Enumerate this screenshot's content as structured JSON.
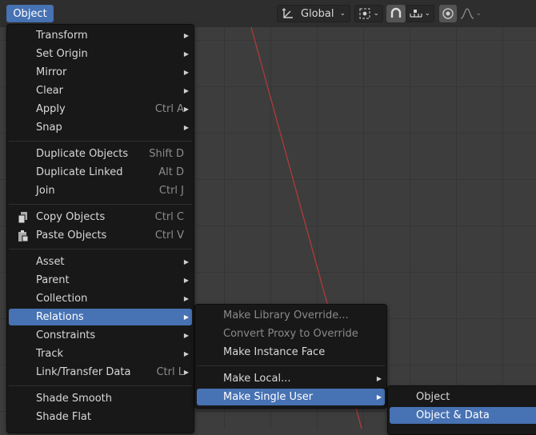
{
  "header": {
    "object_menu": "Object",
    "orientation": "Global",
    "icons": [
      "transform-orientation-icon",
      "pivot-point-icon",
      "snap-magnet-icon",
      "snap-increment-icon",
      "proportional-edit-icon",
      "falloff-curve-icon"
    ]
  },
  "object_menu": {
    "items": [
      {
        "label": "Transform",
        "shortcut": "",
        "submenu": true
      },
      {
        "label": "Set Origin",
        "shortcut": "",
        "submenu": true
      },
      {
        "label": "Mirror",
        "shortcut": "",
        "submenu": true
      },
      {
        "label": "Clear",
        "shortcut": "",
        "submenu": true
      },
      {
        "label": "Apply",
        "shortcut": "Ctrl A",
        "submenu": true
      },
      {
        "label": "Snap",
        "shortcut": "",
        "submenu": true
      },
      {
        "label": "Duplicate Objects",
        "shortcut": "Shift D",
        "submenu": false
      },
      {
        "label": "Duplicate Linked",
        "shortcut": "Alt D",
        "submenu": false
      },
      {
        "label": "Join",
        "shortcut": "Ctrl J",
        "submenu": false
      },
      {
        "label": "Copy Objects",
        "shortcut": "Ctrl C",
        "submenu": false,
        "icon": "copy-icon"
      },
      {
        "label": "Paste Objects",
        "shortcut": "Ctrl V",
        "submenu": false,
        "icon": "paste-icon"
      },
      {
        "label": "Asset",
        "shortcut": "",
        "submenu": true
      },
      {
        "label": "Parent",
        "shortcut": "",
        "submenu": true
      },
      {
        "label": "Collection",
        "shortcut": "",
        "submenu": true
      },
      {
        "label": "Relations",
        "shortcut": "",
        "submenu": true,
        "highlighted": true
      },
      {
        "label": "Constraints",
        "shortcut": "",
        "submenu": true
      },
      {
        "label": "Track",
        "shortcut": "",
        "submenu": true
      },
      {
        "label": "Link/Transfer Data",
        "shortcut": "Ctrl L",
        "submenu": true
      },
      {
        "label": "Shade Smooth",
        "shortcut": "",
        "submenu": false
      },
      {
        "label": "Shade Flat",
        "shortcut": "",
        "submenu": false
      }
    ]
  },
  "relations_menu": {
    "items": [
      {
        "label": "Make Library Override...",
        "disabled": true,
        "submenu": false
      },
      {
        "label": "Convert Proxy to Override",
        "disabled": true,
        "submenu": false
      },
      {
        "label": "Make Instance Face",
        "disabled": false,
        "submenu": false
      },
      {
        "label": "Make Local...",
        "disabled": false,
        "submenu": true
      },
      {
        "label": "Make Single User",
        "disabled": false,
        "submenu": true,
        "highlighted": true
      }
    ]
  },
  "single_user_menu": {
    "items": [
      {
        "label": "Object",
        "highlighted": false
      },
      {
        "label": "Object & Data",
        "highlighted": true
      }
    ]
  },
  "colors": {
    "accent": "#4772b3",
    "menu_bg": "#181818",
    "viewport_bg": "#3d3d3d",
    "x_axis": "#b03a3a"
  }
}
